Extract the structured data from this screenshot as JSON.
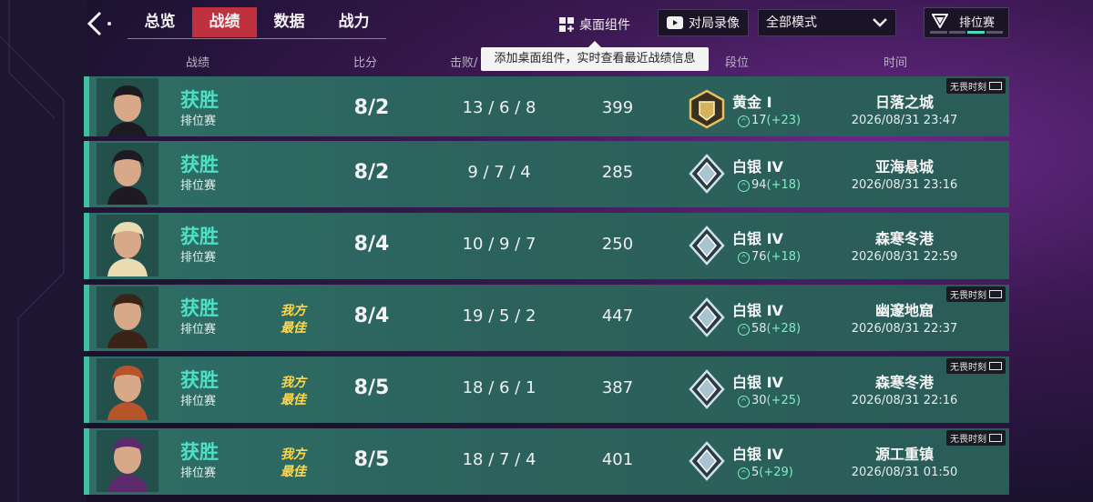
{
  "nav": {
    "tabs": [
      {
        "label": "总览"
      },
      {
        "label": "战绩"
      },
      {
        "label": "数据"
      },
      {
        "label": "战力"
      }
    ],
    "active_tab": "战绩",
    "widget_label": "桌面组件",
    "replay_label": "对局录像",
    "mode_select_value": "全部模式",
    "rank_badge_label": "排位赛"
  },
  "tooltip": "添加桌面组件，实时查看最近战绩信息",
  "columns": {
    "record": "战绩",
    "score": "比分",
    "kda": "击败/",
    "rank": "段位",
    "time": "时间"
  },
  "matches": [
    {
      "result": "获胜",
      "queue": "排位赛",
      "mvp": "",
      "score": "8/2",
      "kda": "13 / 6 / 8",
      "acs": "399",
      "rank": "黄金 I",
      "rr": "17",
      "rr_delta": "(+23)",
      "map": "日落之城",
      "time": "2026/08/31 23:47",
      "fearless": "无畏时刻",
      "rank_tier": "gold",
      "agent_color": "#1e1a22"
    },
    {
      "result": "获胜",
      "queue": "排位赛",
      "mvp": "",
      "score": "8/2",
      "kda": "9 / 7 / 4",
      "acs": "285",
      "rank": "白银 IV",
      "rr": "94",
      "rr_delta": "(+18)",
      "map": "亚海悬城",
      "time": "2026/08/31 23:16",
      "fearless": "",
      "rank_tier": "silver",
      "agent_color": "#1e1a22"
    },
    {
      "result": "获胜",
      "queue": "排位赛",
      "mvp": "",
      "score": "8/4",
      "kda": "10 / 9 / 7",
      "acs": "250",
      "rank": "白银 IV",
      "rr": "76",
      "rr_delta": "(+18)",
      "map": "森寒冬港",
      "time": "2026/08/31 22:59",
      "fearless": "",
      "rank_tier": "silver",
      "agent_color": "#e8dcb0"
    },
    {
      "result": "获胜",
      "queue": "排位赛",
      "mvp": "我方\n最佳",
      "score": "8/4",
      "kda": "19 / 5 / 2",
      "acs": "447",
      "rank": "白银 IV",
      "rr": "58",
      "rr_delta": "(+28)",
      "map": "幽邃地窟",
      "time": "2026/08/31 22:37",
      "fearless": "无畏时刻",
      "rank_tier": "silver",
      "agent_color": "#3a2418"
    },
    {
      "result": "获胜",
      "queue": "排位赛",
      "mvp": "我方\n最佳",
      "score": "8/5",
      "kda": "18 / 6 / 1",
      "acs": "387",
      "rank": "白银 IV",
      "rr": "30",
      "rr_delta": "(+25)",
      "map": "森寒冬港",
      "time": "2026/08/31 22:16",
      "fearless": "无畏时刻",
      "rank_tier": "silver",
      "agent_color": "#b8542a"
    },
    {
      "result": "获胜",
      "queue": "排位赛",
      "mvp": "我方\n最佳",
      "score": "8/5",
      "kda": "18 / 7 / 4",
      "acs": "401",
      "rank": "白银 IV",
      "rr": "5",
      "rr_delta": "(+29)",
      "map": "源工重镇",
      "time": "2026/08/31 01:50",
      "fearless": "无畏时刻",
      "rank_tier": "silver",
      "agent_color": "#5a2a6a"
    }
  ],
  "colors": {
    "accent_red": "#c0313f",
    "win_green": "#4ee0c4",
    "mvp_gold": "#ffd84a"
  }
}
